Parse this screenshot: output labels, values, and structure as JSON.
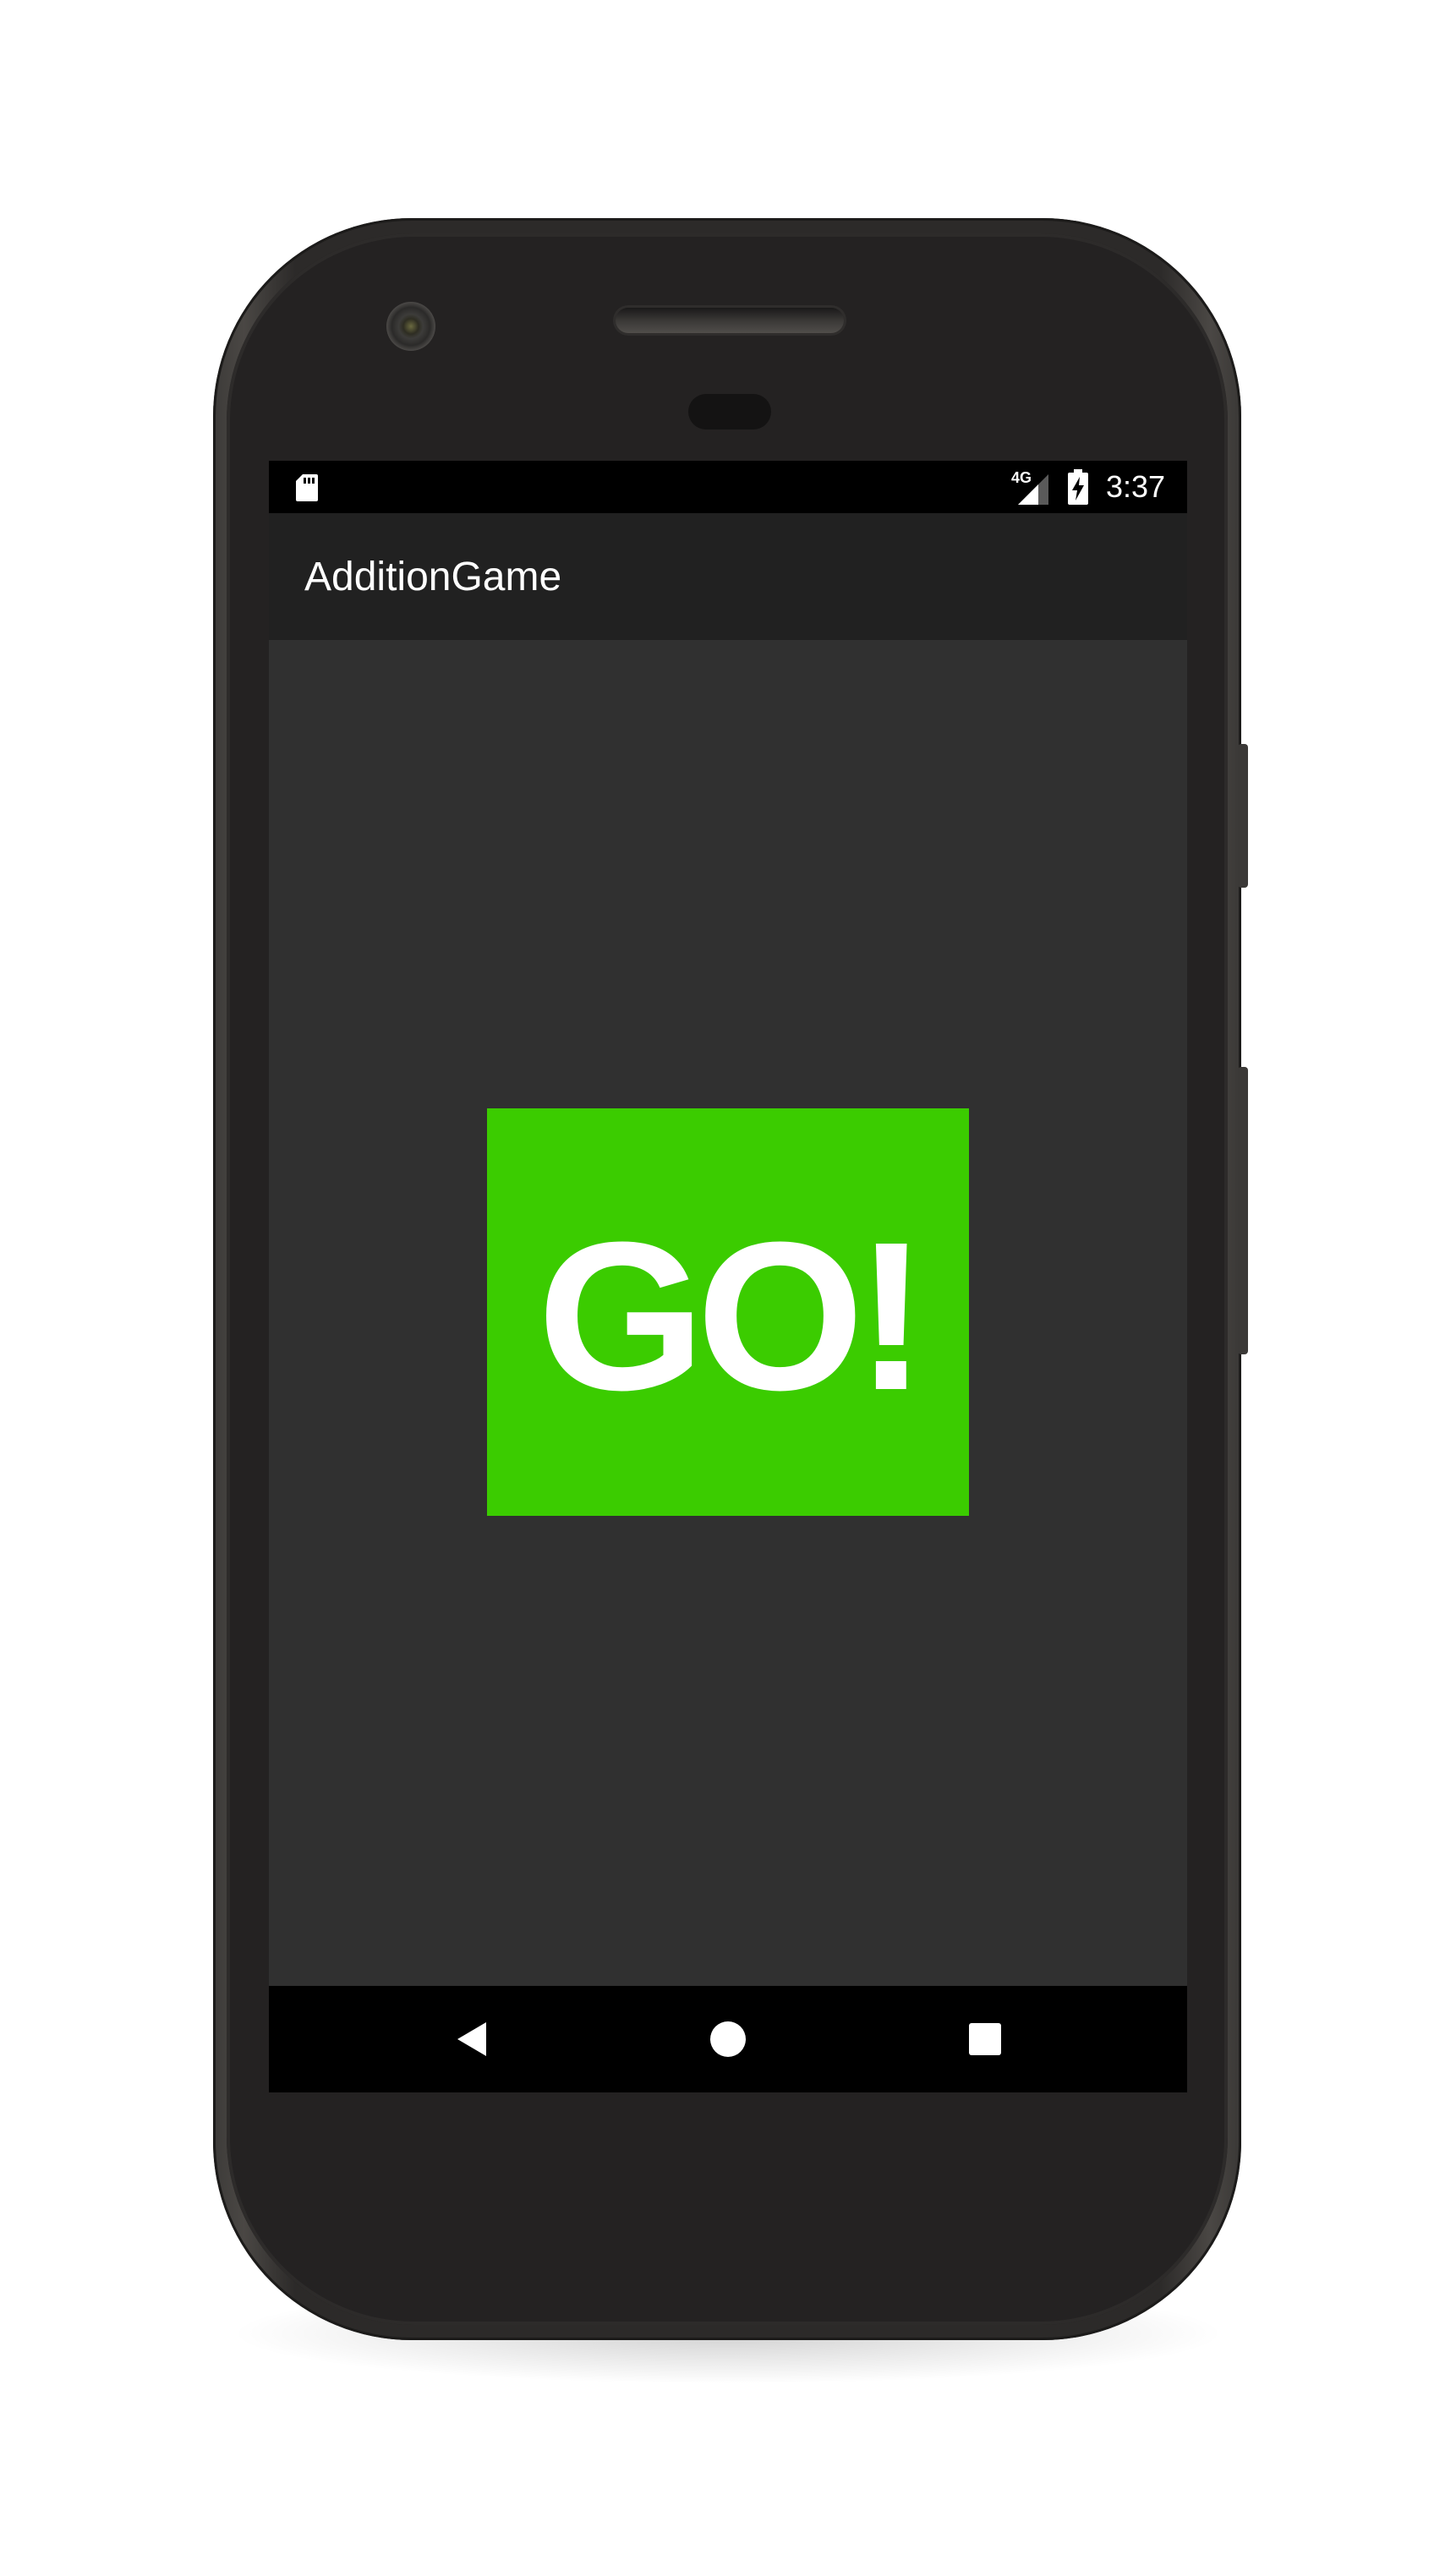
{
  "status_bar": {
    "network_type": "4G",
    "time": "3:37",
    "icons": [
      "sd-card-icon",
      "signal-icon",
      "battery-charging-icon"
    ]
  },
  "app_bar": {
    "title": "AdditionGame"
  },
  "main": {
    "go_button_label": "GO!",
    "go_button_color": "#3bcc00"
  },
  "nav_bar": {
    "icons": [
      "back-icon",
      "home-icon",
      "recents-icon"
    ]
  },
  "colors": {
    "screen_background": "#303030",
    "app_bar_background": "#212121",
    "status_bar_background": "#000000"
  }
}
